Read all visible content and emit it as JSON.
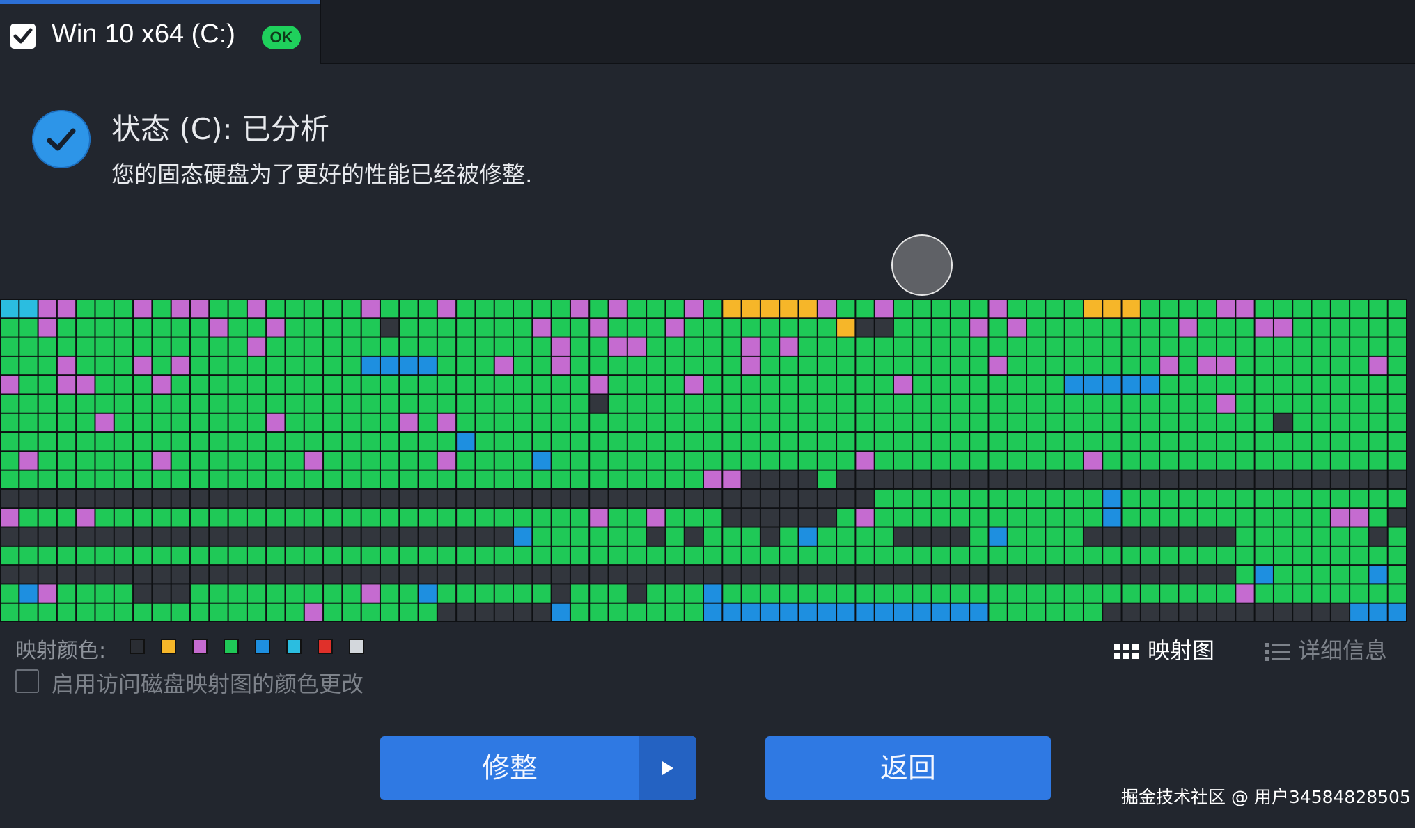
{
  "drive_tab": {
    "checked": true,
    "name": "Win 10 x64 (C:)",
    "badge": "OK",
    "accent_color": "#2c6fd6",
    "badge_color": "#1fd05c"
  },
  "status": {
    "icon": "check-circle-icon",
    "title": "状态 (C): 已分析",
    "description": "您的固态硬盘为了更好的性能已经被修整."
  },
  "disk_map": {
    "columns": 74,
    "rows": 17,
    "palette": {
      "G": "#1fc957",
      "D": "#32363d",
      "P": "#c56bd0",
      "Y": "#f6b629",
      "B": "#1e8fe0",
      "C": "#2bbde0"
    },
    "rows_data": [
      "CCPPGGGPGPPGGPGGGGGPGGGPGGGGGGPGPGGGPGYYYYYPGGPGGGGGPGGGGYYYGGGGPPGGGGGGGGP",
      "GGPGGGGGGGGPGGPGGGGGDGGGGGGGPGGPGGGPGGGGGGGGYDDGGGGPGPGGGGGGGGPGGGPPGGGGGG",
      "GGGGGGGGGGGGGPGGGGGGGGGGGGGGGPGGPPGGGGGPGPGGGGGGGGGGGGGGGGGGGGGGGGGGGGGGGG",
      "GGGPGGGPGPGGGGGGGGGBBBBGGGPGGPGGGGGGGGGPGGGGGGGGGGGGPGGGGGGGGPGPPGGGGGGGPG",
      "PGGPPGGGPGGGGGGGGGGGGGGGGGGGGGGPGGGGPGGGGGGGGGGPGGGGGGGGBBBBBGGGGGGGGGGGGG",
      "GGGGGGGGGGGGGGGGGGGGGGGGGGGGGGGDGGGGGGGGGGGGGGGGGGGGGGGGGGGGGGGGPGGGGGGGGG",
      "GGGGGPGGGGGGGGPGGGGGGPGPGGGGGGGGGGGGGGGGGGGGGGGGGGGGGGGGGGGGGGGGGGGDGGGGGG",
      "GGGGGGGGGGGGGGGGGGGGGGGGBGGGGGGGGGGGGGGGGGGGGGGGGGGGGGGGGGGGGGGGGGGGGGGGGG",
      "GPGGGGGGPGGGGGGGPGGGGGGPGGGGBGGGGGGGGGGGGGGGGPGGGGGGGGGGGPGGGGGGGGGGGGGGG",
      "GGGGGGGGGGGGGGGGGGGGGGGGGGGGGGGGGGGGGPPDDDDGDDDDDDDDDDDDDDDDDDDDDDDDDDDDDD",
      "DDDDDDDDDDDDDDDDDDDDDDDDDDDDDDDDDDDDDDDDDDDDDDGGGGGGGGGGGGBGGGGGGGGGGGGGGG",
      "PGGGPGGGGGGGGGGGGGGGGGGGGGGGGGGPGGPGGGDDDDDDGPGGGGGGGGGGGGBGGGGGGGGGGGPPGDD",
      "DDDDDDDDDDDDDDDDDDDDDDDDDDDBGGGGGGDGDGGGDGBGGGGDDDDGBGGGGDDDDDDDDGGGGGGGDG",
      "GGGGGGGGGGGGGGGGGGGGGGGGGGGGGGGGGGGGGGGGGGGGGGGGGGGGGGGGGGGGGGGGGGGGGGGGGG",
      "DDDDDDDDDDDDDDDDDDDDDDDDDDDDDDDDDDDDDDDDDDDDDDDDDDDDDDDDDDDDDDDDDGBGGGGGBG",
      "GBPGGGGDDDGGGGGGGGGPGGBGGGGGGDGGGDGGGBGGGGGGGGGGGGGGGGGGGGGGGGGGGPGGGGGGGG",
      "GGGGGGGGGGGGGGGGPGGGGGGDDDDDDBGGGGGGGBBBBBBBBBBBBBBBGGGGGGDDDDDDDDDDDDDBBBB"
    ]
  },
  "legend": {
    "label": "映射颜色:",
    "swatches": [
      "#2a2d33",
      "#f6b629",
      "#c56bd0",
      "#1fc957",
      "#1e8fe0",
      "#2bbde0",
      "#e0302a",
      "#d3d7dc"
    ]
  },
  "view_toggle": {
    "map_label": "映射图",
    "details_label": "详细信息"
  },
  "enable_colors": {
    "checked": false,
    "label": "启用访问磁盘映射图的颜色更改"
  },
  "buttons": {
    "trim": "修整",
    "back": "返回"
  },
  "watermark": "掘金技术社区 @ 用户34584828505"
}
